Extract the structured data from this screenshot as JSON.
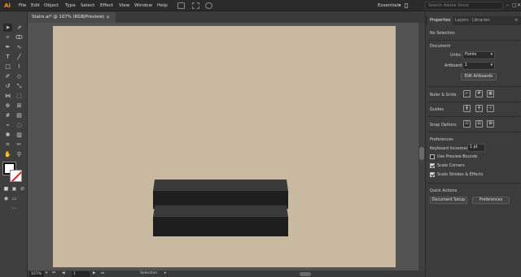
{
  "app": {
    "logo": "Ai"
  },
  "menubar": {
    "items": [
      "File",
      "Edit",
      "Object",
      "Type",
      "Select",
      "Effect",
      "View",
      "Window",
      "Help"
    ],
    "icons": [
      "document-icon",
      "arrange-icon",
      "gpu-icon"
    ],
    "workspace": "Essentials",
    "search_placeholder": "Search Adobe Stock",
    "window_controls": [
      "–",
      "□",
      "✕"
    ]
  },
  "document": {
    "tab_title": "Stairs.ai* @ 107% (RGB/Preview)",
    "tab_close": "×"
  },
  "toolbar": {
    "tools": [
      "selection-tool",
      "direct-selection-tool",
      "magic-wand-tool",
      "lasso-tool",
      "pen-tool",
      "curvature-tool",
      "type-tool",
      "line-segment-tool",
      "rectangle-tool",
      "paintbrush-tool",
      "shaper-tool",
      "eraser-tool",
      "rotate-tool",
      "scale-tool",
      "width-tool",
      "free-transform-tool",
      "shape-builder-tool",
      "perspective-grid-tool",
      "mesh-tool",
      "gradient-tool",
      "eyedropper-tool",
      "blend-tool",
      "symbol-sprayer-tool",
      "column-graph-tool",
      "artboard-tool",
      "slice-tool",
      "hand-tool",
      "zoom-tool"
    ],
    "colors": {
      "fill": "#ffffff",
      "stroke": "none"
    }
  },
  "canvas": {
    "artboard_color": "#c9b9a0",
    "pasteboard_color": "#535353",
    "objects": [
      {
        "name": "stair-step-top",
        "top_color": "#3b3a3b",
        "front_color": "#1f1e1f"
      },
      {
        "name": "stair-step-bottom",
        "top_color": "#3b3a3b",
        "front_color": "#1f1e1f"
      }
    ]
  },
  "statusbar": {
    "zoom": "107%",
    "page": "1",
    "tool": "Selection"
  },
  "panel": {
    "tabs": [
      "Properties",
      "Layers",
      "Libraries"
    ],
    "active_tab": "Properties",
    "selection": "No Selection",
    "document": {
      "heading": "Document",
      "units_label": "Units:",
      "units_value": "Points",
      "artboard_label": "Artboard:",
      "artboard_value": "1",
      "edit_button": "Edit Artboards"
    },
    "ruler": {
      "heading": "Ruler & Grids"
    },
    "guides": {
      "heading": "Guides"
    },
    "snap": {
      "heading": "Snap Options"
    },
    "preferences": {
      "heading": "Preferences",
      "keyboard_increment_label": "Keyboard Increment:",
      "keyboard_increment_value": "1 pt",
      "checkboxes": [
        {
          "label": "Use Preview Bounds",
          "checked": false
        },
        {
          "label": "Scale Corners",
          "checked": true
        },
        {
          "label": "Scale Strokes & Effects",
          "checked": true
        }
      ]
    },
    "quick_actions": {
      "heading": "Quick Actions",
      "document_setup": "Document Setup",
      "preferences_button": "Preferences"
    }
  }
}
